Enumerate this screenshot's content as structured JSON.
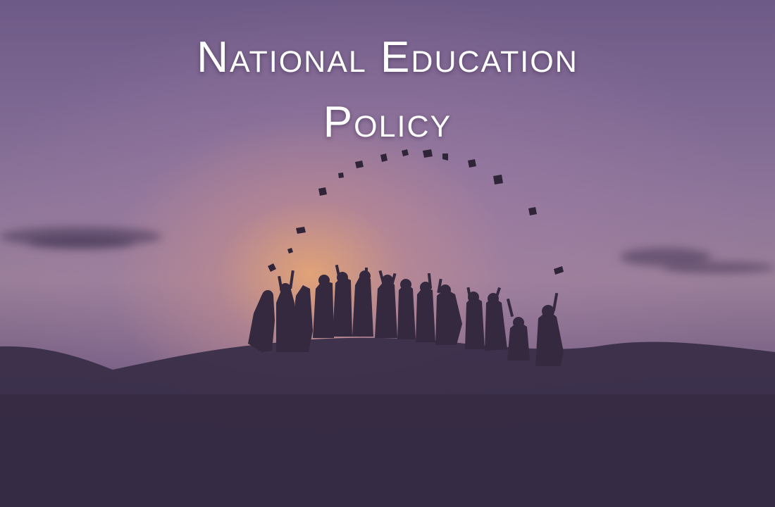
{
  "title": {
    "line1": "National Education",
    "line2": "Policy"
  },
  "colors": {
    "sky_top": "#6e5a86",
    "sunset_glow": "#eca870",
    "silhouette": "#3b2f4a",
    "title_text": "#ffffff"
  }
}
